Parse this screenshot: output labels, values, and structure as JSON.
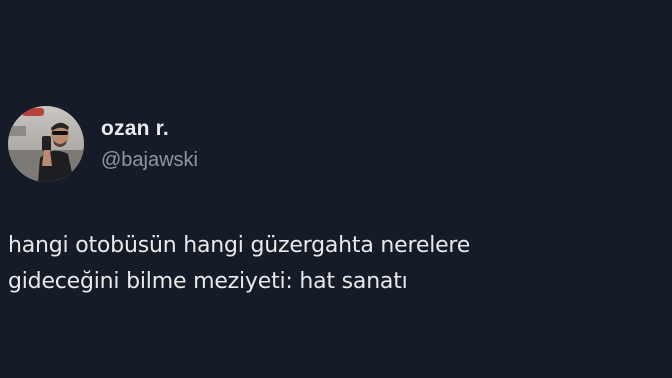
{
  "author": {
    "display_name": "ozan r.",
    "handle": "@bajawski"
  },
  "tweet": {
    "lines": [
      "hangi otobüsün hangi güzergahta nerelere",
      "gideceğini bilme meziyeti: hat sanatı"
    ]
  },
  "colors": {
    "background": "#151c27",
    "primary_text": "#e7e9ea",
    "secondary_text": "#8b98a5"
  }
}
